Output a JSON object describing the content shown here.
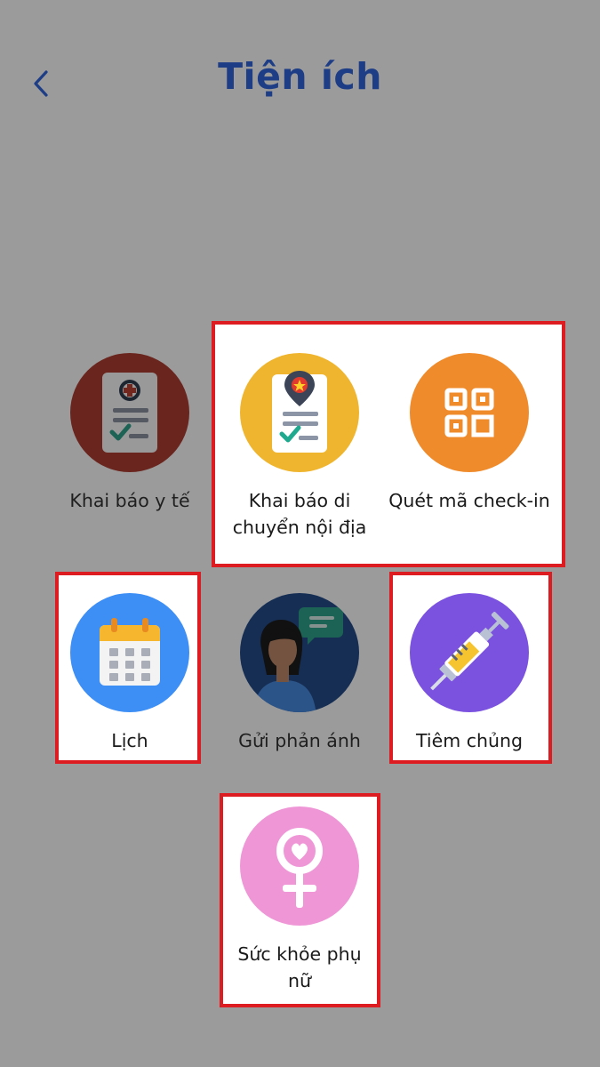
{
  "header": {
    "title": "Tiện ích",
    "back_icon": "chevron-left-icon"
  },
  "colors": {
    "background": "#9b9b9b",
    "title": "#1d3d86",
    "highlight_border": "#dd1c22",
    "medical": "#c0392b",
    "domestic": "#f0b52e",
    "qr": "#f08b2c",
    "calendar": "#3d8ef5",
    "feedback": "#1f4d97",
    "vaccine": "#7b52e0",
    "women": "#ef96d6"
  },
  "utilities": [
    {
      "label": "Khai báo y tế",
      "icon": "medical-form-icon",
      "highlighted": false
    },
    {
      "label": "Khai báo di chuyển nội địa",
      "icon": "domestic-travel-form-icon",
      "highlighted": true
    },
    {
      "label": "Quét mã check-in",
      "icon": "qr-scan-icon",
      "highlighted": true
    },
    {
      "label": "Lịch",
      "icon": "calendar-icon",
      "highlighted": true
    },
    {
      "label": "Gửi phản ánh",
      "icon": "feedback-icon",
      "highlighted": false
    },
    {
      "label": "Tiêm chủng",
      "icon": "syringe-icon",
      "highlighted": true
    },
    {
      "label": "Sức khỏe phụ nữ",
      "icon": "female-symbol-icon",
      "highlighted": true
    }
  ]
}
